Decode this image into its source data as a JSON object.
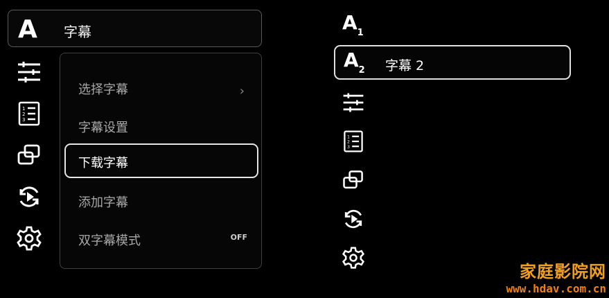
{
  "left_panel": {
    "header_label": "字幕",
    "submenu": [
      {
        "label": "选择字幕",
        "has_chevron": true
      },
      {
        "label": "字幕设置"
      },
      {
        "label": "下载字幕",
        "selected": true
      },
      {
        "label": "添加字幕"
      },
      {
        "label": "双字幕模式",
        "toggle_value": "OFF"
      }
    ],
    "chevron": "›"
  },
  "right_panel": {
    "item1_sub": "1",
    "item2_sub": "2",
    "selected_label": "字幕 2"
  },
  "watermark": {
    "logo": "家庭影院网",
    "url": "www.hdav.com.cn"
  },
  "colors": {
    "background": "#000000",
    "border_active": "#e6e6e6",
    "text_dim": "#a8a8a8",
    "watermark": "#f0a020"
  }
}
